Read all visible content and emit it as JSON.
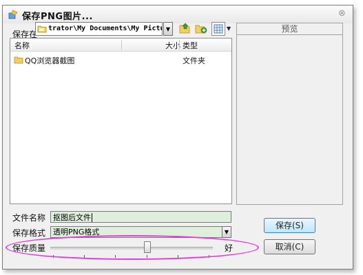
{
  "window": {
    "title": "保存PNG图片..."
  },
  "location": {
    "label": "保存在",
    "path": "trator\\My Documents\\My Pictures"
  },
  "file_list": {
    "columns": [
      "名称",
      "大小",
      "类型"
    ],
    "rows": [
      {
        "name": "QQ浏览器截图",
        "size": "",
        "type": "文件夹"
      }
    ]
  },
  "preview": {
    "title": "预览"
  },
  "filename": {
    "label": "文件名称",
    "value": "抠图后文件"
  },
  "format": {
    "label": "保存格式",
    "value": "透明PNG格式"
  },
  "quality": {
    "label": "保存质量",
    "right_label": "好",
    "level": 0.59
  },
  "buttons": {
    "save": "保存(S)",
    "cancel": "取消(C)"
  },
  "colors": {
    "field_bg": "#dfeedd",
    "highlight": "#e43ad9",
    "save_btn": "#bee6fd"
  }
}
